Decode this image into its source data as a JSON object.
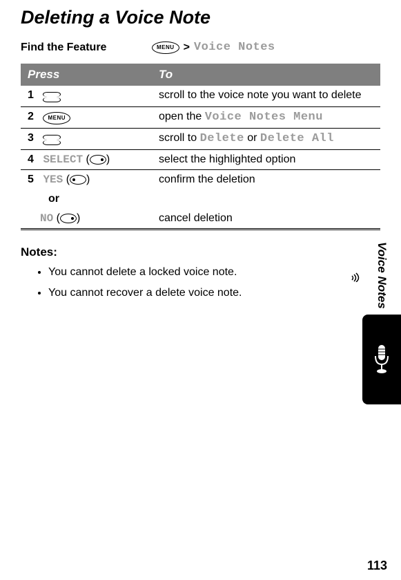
{
  "title": "Deleting a Voice Note",
  "findFeature": {
    "label": "Find the Feature",
    "menuKey": "MENU",
    "arrow": ">",
    "path": "Voice Notes"
  },
  "table": {
    "headers": {
      "press": "Press",
      "to": "To"
    },
    "rows": [
      {
        "num": "1",
        "desc_pre": "scroll to the voice note you want to delete"
      },
      {
        "num": "2",
        "desc_pre": "open the ",
        "mono": "Voice Notes Menu"
      },
      {
        "num": "3",
        "desc_pre": "scroll to ",
        "mono": "Delete",
        "desc_mid": " or ",
        "mono2": "Delete All"
      },
      {
        "num": "4",
        "action": "SELECT",
        "desc_pre": "select the highlighted option"
      },
      {
        "num": "5",
        "action": "YES",
        "desc_pre": "confirm the deletion"
      }
    ],
    "or": "or",
    "noRow": {
      "action": "NO",
      "desc": "cancel deletion"
    }
  },
  "notes": {
    "heading": "Notes:",
    "items": [
      "You cannot delete a locked voice note.",
      "You cannot recover a delete voice note."
    ]
  },
  "sideTab": "Voice Notes",
  "pageNumber": "113"
}
